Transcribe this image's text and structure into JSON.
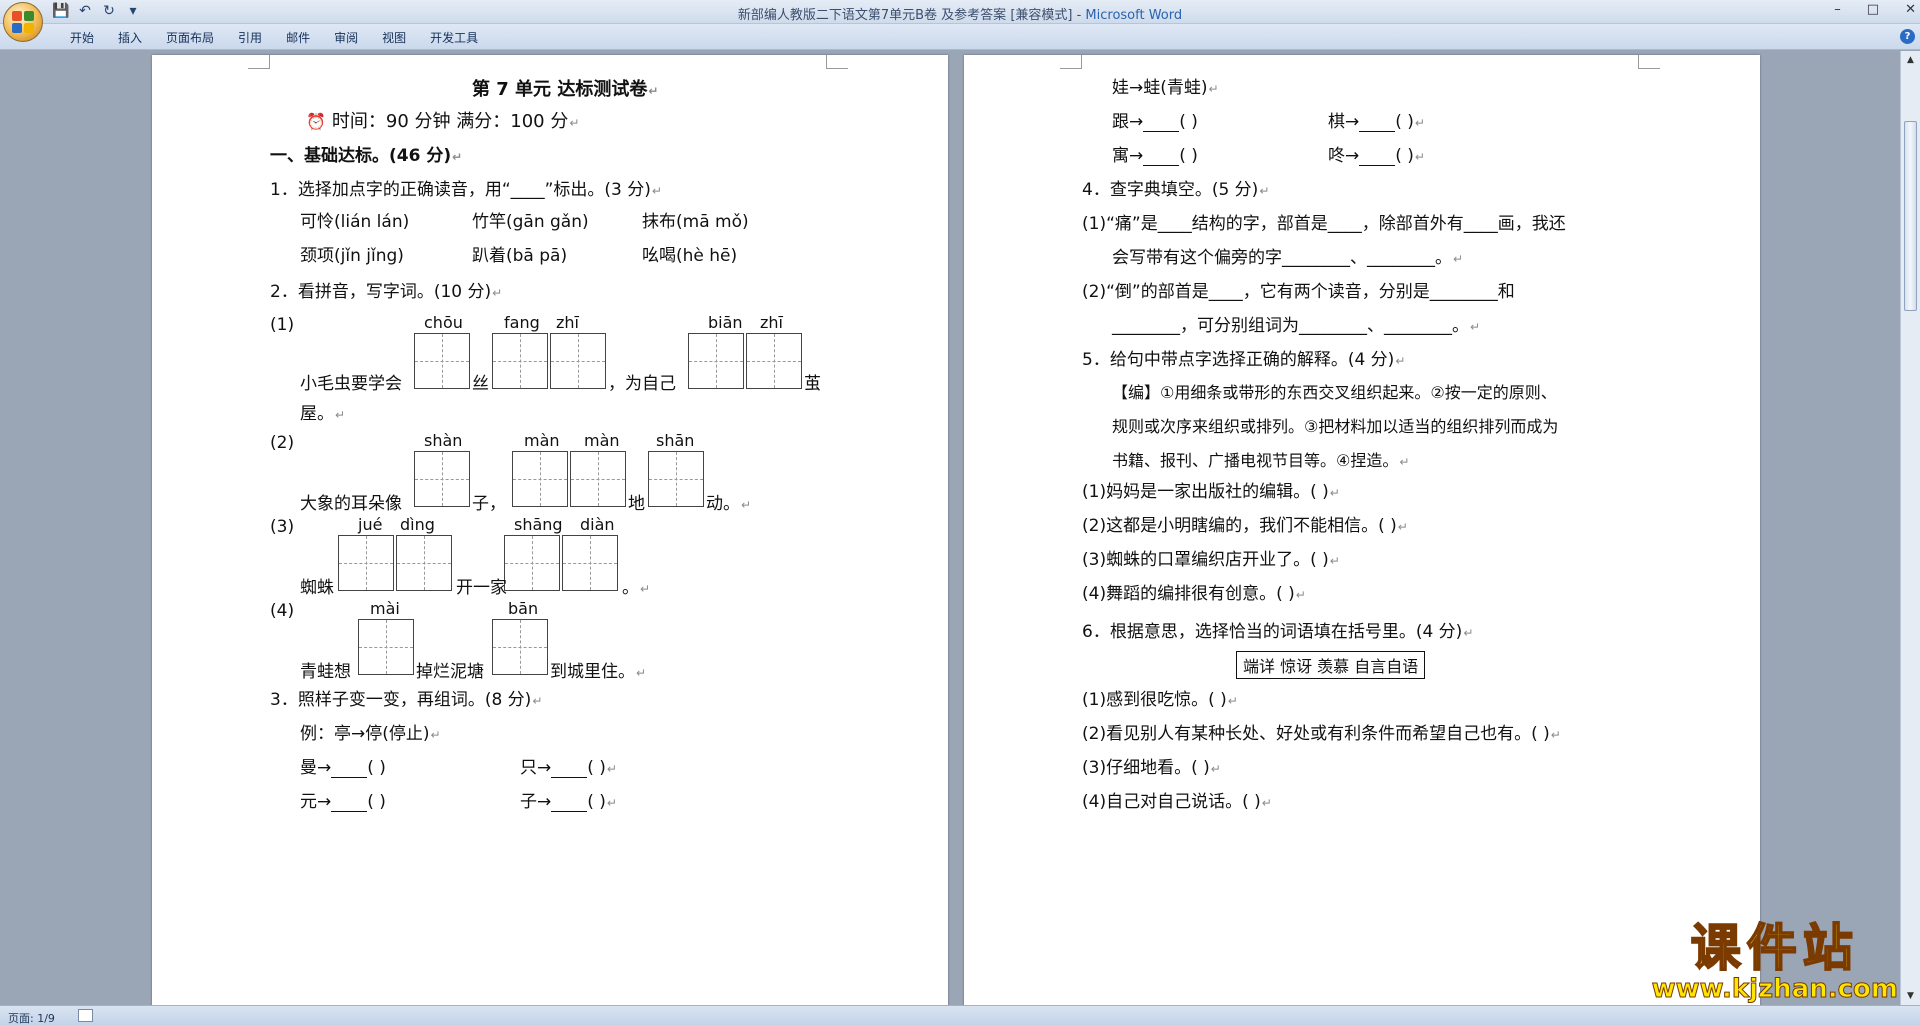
{
  "window": {
    "title": "新部编人教版二下语文第7单元B卷 及参考答案 [兼容模式] - ",
    "app": "Microsoft Word",
    "minimize": "–",
    "maximize": "□",
    "close": "✕"
  },
  "qat": {
    "save": "💾",
    "undo": "↶",
    "redo": "↻",
    "more": "▾"
  },
  "ribbon": {
    "tabs": [
      "开始",
      "插入",
      "页面布局",
      "引用",
      "邮件",
      "审阅",
      "视图",
      "开发工具"
    ],
    "help": "?"
  },
  "status": {
    "page": "页面: 1/9"
  },
  "watermark": {
    "title": "课件站",
    "url": "www.kjzhan.com"
  },
  "para": "↵",
  "left": {
    "title": "第 7 单元  达标测试卷",
    "time": "时间：90 分钟   满分：100 分",
    "sec1": "一、基础达标。(46 分)",
    "q1": "1．选择加点字的正确读音，用“____”标出。(3 分)",
    "q1a": "可怜(lián   lán)",
    "q1b": "竹竿(gān   gǎn)",
    "q1c": "抹布(mā   mǒ)",
    "q1d": "颈项(jǐn   jǐng)",
    "q1e": "趴着(bā   pā)",
    "q1f": "吆喝(hè   hē)",
    "q2": "2．看拼音，写字词。(10 分)",
    "n1": "(1)",
    "p1a": "chōu",
    "p1b": "fang",
    "p1c": "zhī",
    "p1d": "biān",
    "p1e": "zhī",
    "s1a": "小毛虫要学会",
    "s1b": "丝",
    "s1c": "，为自己",
    "s1d": "茧",
    "s1e": "屋。",
    "n2": "(2)",
    "p2a": "shàn",
    "p2b": "màn",
    "p2c": "màn",
    "p2d": "shān",
    "s2a": "大象的耳朵像",
    "s2b": "子，",
    "s2c": "地",
    "s2d": "动。",
    "n3": "(3)",
    "p3a": "jué",
    "p3b": "dìng",
    "p3c": "shāng",
    "p3d": "diàn",
    "s3a": "蜘蛛",
    "s3b": "开一家",
    "s3c": "。",
    "n4": "(4)",
    "p4a": "mài",
    "p4b": "bān",
    "s4a": "青蛙想",
    "s4b": "掉烂泥塘",
    "s4c": "到城里住。",
    "q3": "3．照样子变一变，再组词。(8 分)",
    "ex": "例：亭→停(停止)",
    "r1a": "曼→",
    "r1b": "只→",
    "r2a": "元→",
    "r2b": "子→",
    "paren": "(      )"
  },
  "right": {
    "r0": "娃→蛙(青蛙)",
    "r1a": "跟→",
    "r1b": "棋→",
    "r2a": "寓→",
    "r2b": "咚→",
    "paren": "(      )",
    "q4": "4．查字典填空。(5 分)",
    "q4a": "(1)“痛”是____结构的字，部首是____，除部首外有____画，我还",
    "q4b": "会写带有这个偏旁的字________、________。",
    "q4c": "(2)“倒”的部首是____，它有两个读音，分别是________和",
    "q4d": "________，可分别组词为________、________。",
    "q5": "5．给句中带点字选择正确的解释。(4 分)",
    "q5d1": "【编】①用细条或带形的东西交叉组织起来。②按一定的原则、",
    "q5d2": "规则或次序来组织或排列。③把材料加以适当的组织排列而成为",
    "q5d3": "书籍、报刊、广播电视节目等。④捏造。",
    "q5a": "(1)妈妈是一家出版社的编辑。(      )",
    "q5b": "(2)这都是小明瞎编的，我们不能相信。(      )",
    "q5c": "(3)蜘蛛的口罩编织店开业了。(      )",
    "q5e": "(4)舞蹈的编排很有创意。(      )",
    "q6": "6．根据意思，选择恰当的词语填在括号里。(4 分)",
    "words": "端详   惊讶   羡慕   自言自语",
    "q6a": "(1)感到很吃惊。(            )",
    "q6b": "(2)看见别人有某种长处、好处或有利条件而希望自己也有。(            )",
    "q6c": "(3)仔细地看。(            )",
    "q6d": "(4)自己对自己说话。(            )"
  }
}
